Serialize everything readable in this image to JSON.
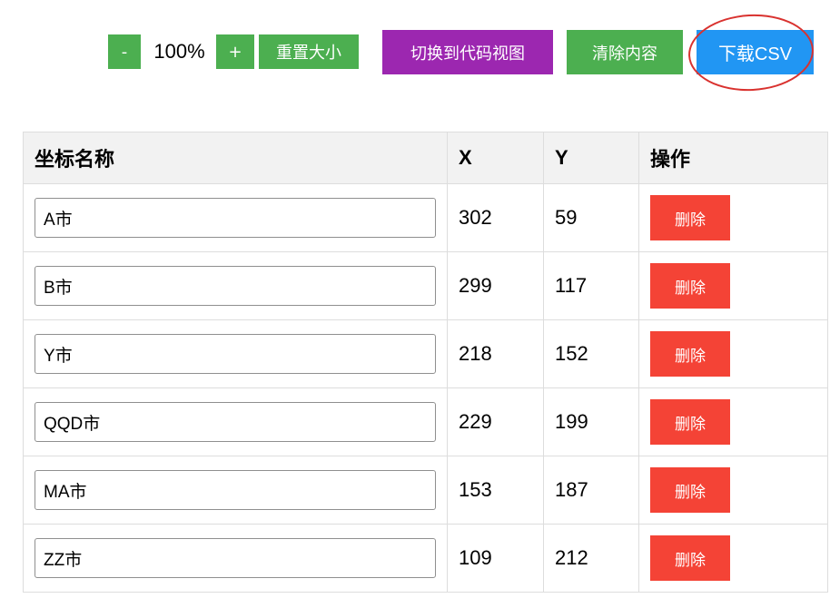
{
  "toolbar": {
    "zoom_out_label": "-",
    "zoom_level": "100%",
    "zoom_in_label": "+",
    "reset_label": "重置大小",
    "toggle_code_label": "切换到代码视图",
    "clear_label": "清除内容",
    "download_label": "下载CSV"
  },
  "colors": {
    "green": "#4caf50",
    "purple": "#9c27b0",
    "blue": "#2196f3",
    "red": "#f44336",
    "annotation_circle": "#d9322f"
  },
  "table": {
    "headers": [
      "坐标名称",
      "X",
      "Y",
      "操作"
    ],
    "delete_label": "删除",
    "rows": [
      {
        "name": "A市",
        "x": "302",
        "y": "59"
      },
      {
        "name": "B市",
        "x": "299",
        "y": "117"
      },
      {
        "name": "Y市",
        "x": "218",
        "y": "152"
      },
      {
        "name": "QQD市",
        "x": "229",
        "y": "199"
      },
      {
        "name": "MA市",
        "x": "153",
        "y": "187"
      },
      {
        "name": "ZZ市",
        "x": "109",
        "y": "212"
      }
    ]
  }
}
